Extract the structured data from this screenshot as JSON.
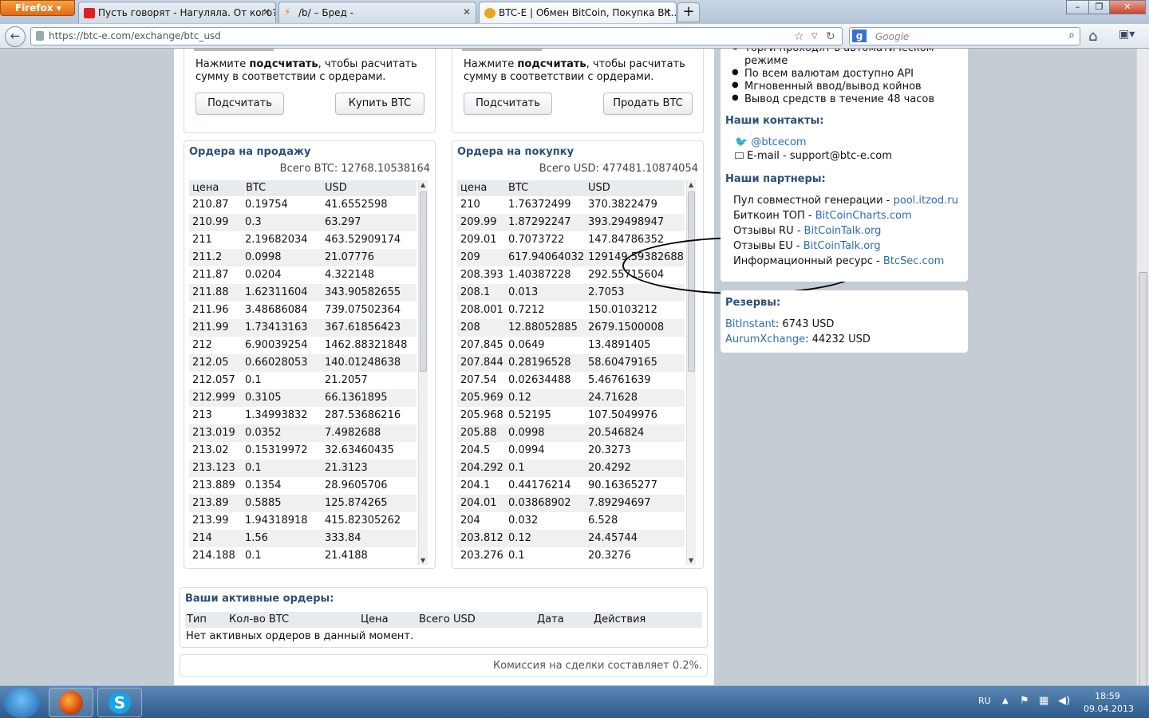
{
  "browser": {
    "menu_label": "Firefox",
    "tabs": [
      {
        "label": "Пусть говорят - Нагуляла. От кого? ...",
        "active": false
      },
      {
        "label": "/b/ – Бред -",
        "active": false
      },
      {
        "label": "BTC-E | Обмен BitCoin, Покупка Bit...",
        "active": true
      }
    ],
    "new_tab": "+",
    "url": "https://btc-e.com/exchange/btc_usd",
    "search_placeholder": "Google",
    "search_engine_glyph": "g"
  },
  "buy_calc": {
    "hint_pre": "Нажмите ",
    "hint_bold": "подсчитать",
    "hint_post": ", чтобы расчитать сумму в соответствии с ордерами.",
    "calc_button": "Подсчитать",
    "action_button": "Купить BTC"
  },
  "sell_calc": {
    "hint_pre": "Нажмите ",
    "hint_bold": "подсчитать",
    "hint_post": ", чтобы расчитать сумму в соответствии с ордерами.",
    "calc_button": "Подсчитать",
    "action_button": "Продать BTC"
  },
  "sell_orders": {
    "title": "Ордера на продажу",
    "total": "Всего BTC: 12768.10538164",
    "headers": [
      "цена",
      "BTC",
      "USD"
    ],
    "rows": [
      [
        "210.87",
        "0.19754",
        "41.6552598"
      ],
      [
        "210.99",
        "0.3",
        "63.297"
      ],
      [
        "211",
        "2.19682034",
        "463.52909174"
      ],
      [
        "211.2",
        "0.0998",
        "21.07776"
      ],
      [
        "211.87",
        "0.0204",
        "4.322148"
      ],
      [
        "211.88",
        "1.62311604",
        "343.90582655"
      ],
      [
        "211.96",
        "3.48686084",
        "739.07502364"
      ],
      [
        "211.99",
        "1.73413163",
        "367.61856423"
      ],
      [
        "212",
        "6.90039254",
        "1462.88321848"
      ],
      [
        "212.05",
        "0.66028053",
        "140.01248638"
      ],
      [
        "212.057",
        "0.1",
        "21.2057"
      ],
      [
        "212.999",
        "0.3105",
        "66.1361895"
      ],
      [
        "213",
        "1.34993832",
        "287.53686216"
      ],
      [
        "213.019",
        "0.0352",
        "7.4982688"
      ],
      [
        "213.02",
        "0.15319972",
        "32.63460435"
      ],
      [
        "213.123",
        "0.1",
        "21.3123"
      ],
      [
        "213.889",
        "0.1354",
        "28.9605706"
      ],
      [
        "213.89",
        "0.5885",
        "125.874265"
      ],
      [
        "213.99",
        "1.94318918",
        "415.82305262"
      ],
      [
        "214",
        "1.56",
        "333.84"
      ],
      [
        "214.188",
        "0.1",
        "21.4188"
      ]
    ]
  },
  "buy_orders": {
    "title": "Ордера на покупку",
    "total": "Всего USD: 477481.10874054",
    "headers": [
      "цена",
      "BTC",
      "USD"
    ],
    "rows": [
      [
        "210",
        "1.76372499",
        "370.3822479"
      ],
      [
        "209.99",
        "1.87292247",
        "393.29498947"
      ],
      [
        "209.01",
        "0.7073722",
        "147.84786352"
      ],
      [
        "209",
        "617.94064032",
        "129149.59382688"
      ],
      [
        "208.393",
        "1.40387228",
        "292.55715604"
      ],
      [
        "208.1",
        "0.013",
        "2.7053"
      ],
      [
        "208.001",
        "0.7212",
        "150.0103212"
      ],
      [
        "208",
        "12.88052885",
        "2679.1500008"
      ],
      [
        "207.845",
        "0.0649",
        "13.4891405"
      ],
      [
        "207.844",
        "0.28196528",
        "58.60479165"
      ],
      [
        "207.54",
        "0.02634488",
        "5.46761639"
      ],
      [
        "205.969",
        "0.12",
        "24.71628"
      ],
      [
        "205.968",
        "0.52195",
        "107.5049976"
      ],
      [
        "205.88",
        "0.0998",
        "20.546824"
      ],
      [
        "204.5",
        "0.0994",
        "20.3273"
      ],
      [
        "204.292",
        "0.1",
        "20.4292"
      ],
      [
        "204.1",
        "0.44176214",
        "90.16365277"
      ],
      [
        "204.01",
        "0.03868902",
        "7.89294697"
      ],
      [
        "204",
        "0.032",
        "6.528"
      ],
      [
        "203.812",
        "0.12",
        "24.45744"
      ],
      [
        "203.276",
        "0.1",
        "20.3276"
      ]
    ]
  },
  "active_orders": {
    "title": "Ваши активные ордеры:",
    "headers": [
      "Тип",
      "Кол-во BTC",
      "Цена",
      "Всего USD",
      "Дата",
      "Действия"
    ],
    "empty": "Нет активных ордеров в данный момент."
  },
  "fee_note": "Комиссия на сделки составляет 0.2%.",
  "sidebar": {
    "features": [
      "Торги проходят в автоматическом",
      "режиме",
      "По всем валютам доступно API",
      "Мгновенный ввод/вывод койнов",
      "Вывод средств в течение 48 часов"
    ],
    "contacts_title": "Наши контакты:",
    "twitter": "@btcecom",
    "email_label": "E-mail - ",
    "email": "support@btc-e.com",
    "partners_title": "Наши партнеры:",
    "partners": [
      {
        "label": "Пул совместной генерации - ",
        "link": "pool.itzod.ru"
      },
      {
        "label": "Биткоин ТОП - ",
        "link": "BitCoinCharts.com"
      },
      {
        "label": "Отзывы RU - ",
        "link": "BitCoinTalk.org"
      },
      {
        "label": "Отзывы EU - ",
        "link": "BitCoinTalk.org"
      },
      {
        "label": "Информационный ресурс - ",
        "link": "BtcSec.com"
      }
    ],
    "reserves_title": "Резервы:",
    "reserves": [
      {
        "link": "BitInstant",
        "value": ": 6743 USD"
      },
      {
        "link": "AurumXchange",
        "value": ": 44232 USD"
      }
    ]
  },
  "taskbar": {
    "lang": "RU",
    "time": "18:59",
    "date": "09.04.2013"
  }
}
